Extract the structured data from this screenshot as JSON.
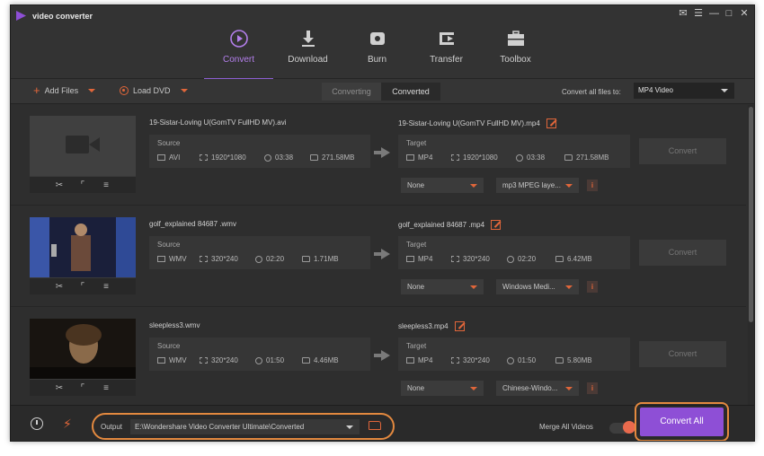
{
  "app": {
    "title": "video converter",
    "window_controls": [
      "chat-icon",
      "menu-icon",
      "minimize-icon",
      "maximize-icon",
      "close-icon"
    ]
  },
  "nav": {
    "items": [
      {
        "label": "Convert",
        "icon": "convert-icon",
        "active": true
      },
      {
        "label": "Download",
        "icon": "download-icon",
        "active": false
      },
      {
        "label": "Burn",
        "icon": "burn-icon",
        "active": false
      },
      {
        "label": "Transfer",
        "icon": "transfer-icon",
        "active": false
      },
      {
        "label": "Toolbox",
        "icon": "toolbox-icon",
        "active": false
      }
    ]
  },
  "toolbar": {
    "add_files": "Add Files",
    "load_dvd": "Load DVD",
    "tabs": [
      "Converting",
      "Converted"
    ],
    "convert_all_label": "Convert all files to:",
    "format": "MP4 Video"
  },
  "files": [
    {
      "source_name": "19-Sistar-Loving U(GomTV FullHD MV).avi",
      "target_name": "19-Sistar-Loving U(GomTV FullHD MV).mp4",
      "source": {
        "label": "Source",
        "format": "AVI",
        "resolution": "1920*1080",
        "duration": "03:38",
        "size": "271.58MB"
      },
      "target": {
        "label": "Target",
        "format": "MP4",
        "resolution": "1920*1080",
        "duration": "03:38",
        "size": "271.58MB"
      },
      "subtitle": "None",
      "audio": "mp3 MPEG laye...",
      "convert": "Convert"
    },
    {
      "source_name": "golf_explained 84687 .wmv",
      "target_name": "golf_explained 84687 .mp4",
      "source": {
        "label": "Source",
        "format": "WMV",
        "resolution": "320*240",
        "duration": "02:20",
        "size": "1.71MB"
      },
      "target": {
        "label": "Target",
        "format": "MP4",
        "resolution": "320*240",
        "duration": "02:20",
        "size": "6.42MB"
      },
      "subtitle": "None",
      "audio": "Windows Medi...",
      "convert": "Convert"
    },
    {
      "source_name": "sleepless3.wmv",
      "target_name": "sleepless3.mp4",
      "source": {
        "label": "Source",
        "format": "WMV",
        "resolution": "320*240",
        "duration": "01:50",
        "size": "4.46MB"
      },
      "target": {
        "label": "Target",
        "format": "MP4",
        "resolution": "320*240",
        "duration": "01:50",
        "size": "5.80MB"
      },
      "subtitle": "None",
      "audio": "Chinese-Windo...",
      "convert": "Convert"
    }
  ],
  "thumb_tools": [
    "scissors-icon",
    "crop-icon",
    "effects-icon"
  ],
  "bottom": {
    "output_label": "Output",
    "output_path": "E:\\Wondershare Video Converter Ultimate\\Converted",
    "merge_label": "Merge All Videos",
    "merge_on": true,
    "convert_all": "Convert All"
  },
  "colors": {
    "accent": "#8e4fd6",
    "orange": "#e0663a",
    "highlight": "#e3893f"
  }
}
